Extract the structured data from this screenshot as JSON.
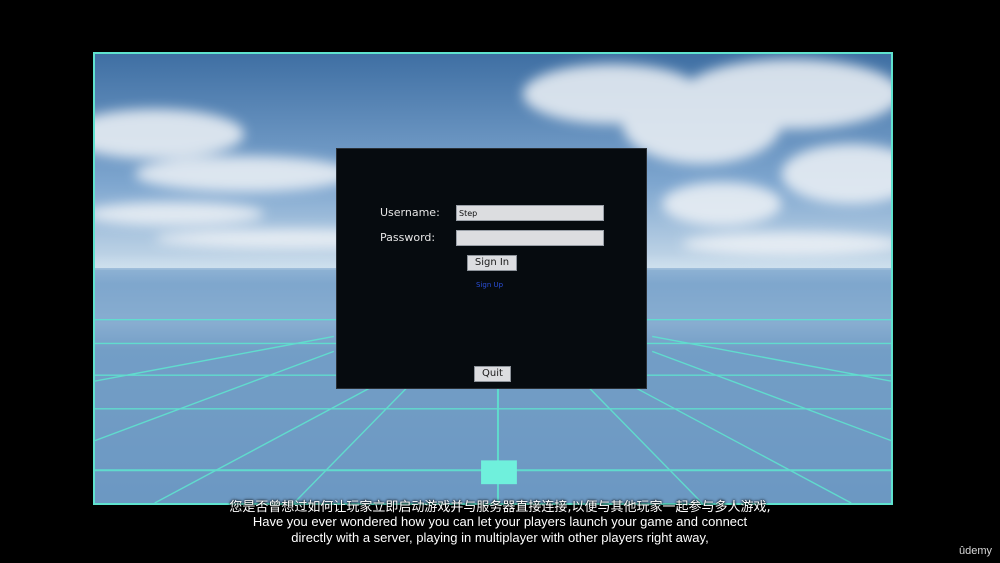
{
  "login": {
    "username_label": "Username:",
    "password_label": "Password:",
    "username_value": "Step",
    "password_value": "",
    "sign_in_label": "Sign In",
    "sign_up_label": "Sign Up",
    "quit_label": "Quit"
  },
  "subtitles": {
    "chinese": "您是否曾想过如何让玩家立即启动游戏并与服务器直接连接,以便与其他玩家一起参与多人游戏,",
    "english_line1": "Have you ever wondered how you can let your players launch your game and connect",
    "english_line2": "directly with a server, playing in multiplayer with other players right away,"
  },
  "brand": "ûdemy",
  "colors": {
    "grid_line": "#5fe3cf",
    "dialog_bg": "#060b0f",
    "link": "#2a4ed8"
  }
}
